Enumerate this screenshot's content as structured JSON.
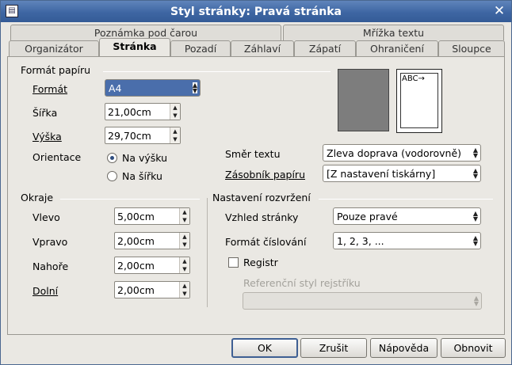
{
  "window": {
    "title": "Styl stránky: Pravá stránka"
  },
  "tabs_back": [
    "Poznámka pod čarou",
    "Mřížka textu"
  ],
  "tabs_front": [
    "Organizátor",
    "Stránka",
    "Pozadí",
    "Záhlaví",
    "Zápatí",
    "Ohraničení",
    "Sloupce"
  ],
  "paper": {
    "section": "Formát papíru",
    "format_label": "Formát",
    "format_value": "A4",
    "width_label": "Šířka",
    "width_value": "21,00cm",
    "height_label": "Výška",
    "height_value": "29,70cm",
    "orientation_label": "Orientace",
    "portrait": "Na výšku",
    "landscape": "Na šířku",
    "text_dir_label": "Směr textu",
    "text_dir_value": "Zleva doprava (vodorovně)",
    "tray_label": "Zásobník papíru",
    "tray_value": "[Z nastavení tiskárny]",
    "preview_text": "ABC→"
  },
  "margins": {
    "section": "Okraje",
    "left_label": "Vlevo",
    "left_value": "5,00cm",
    "right_label": "Vpravo",
    "right_value": "2,00cm",
    "top_label": "Nahoře",
    "top_value": "2,00cm",
    "bottom_label": "Dolní",
    "bottom_value": "2,00cm"
  },
  "layout": {
    "section": "Nastavení rozvržení",
    "page_layout_label": "Vzhled stránky",
    "page_layout_value": "Pouze pravé",
    "numbering_label": "Formát číslování",
    "numbering_value": "1, 2, 3, ...",
    "register_label": "Registr",
    "ref_style_label": "Referenční styl rejstříku"
  },
  "buttons": {
    "ok": "OK",
    "cancel": "Zrušit",
    "help": "Nápověda",
    "reset": "Obnovit"
  }
}
